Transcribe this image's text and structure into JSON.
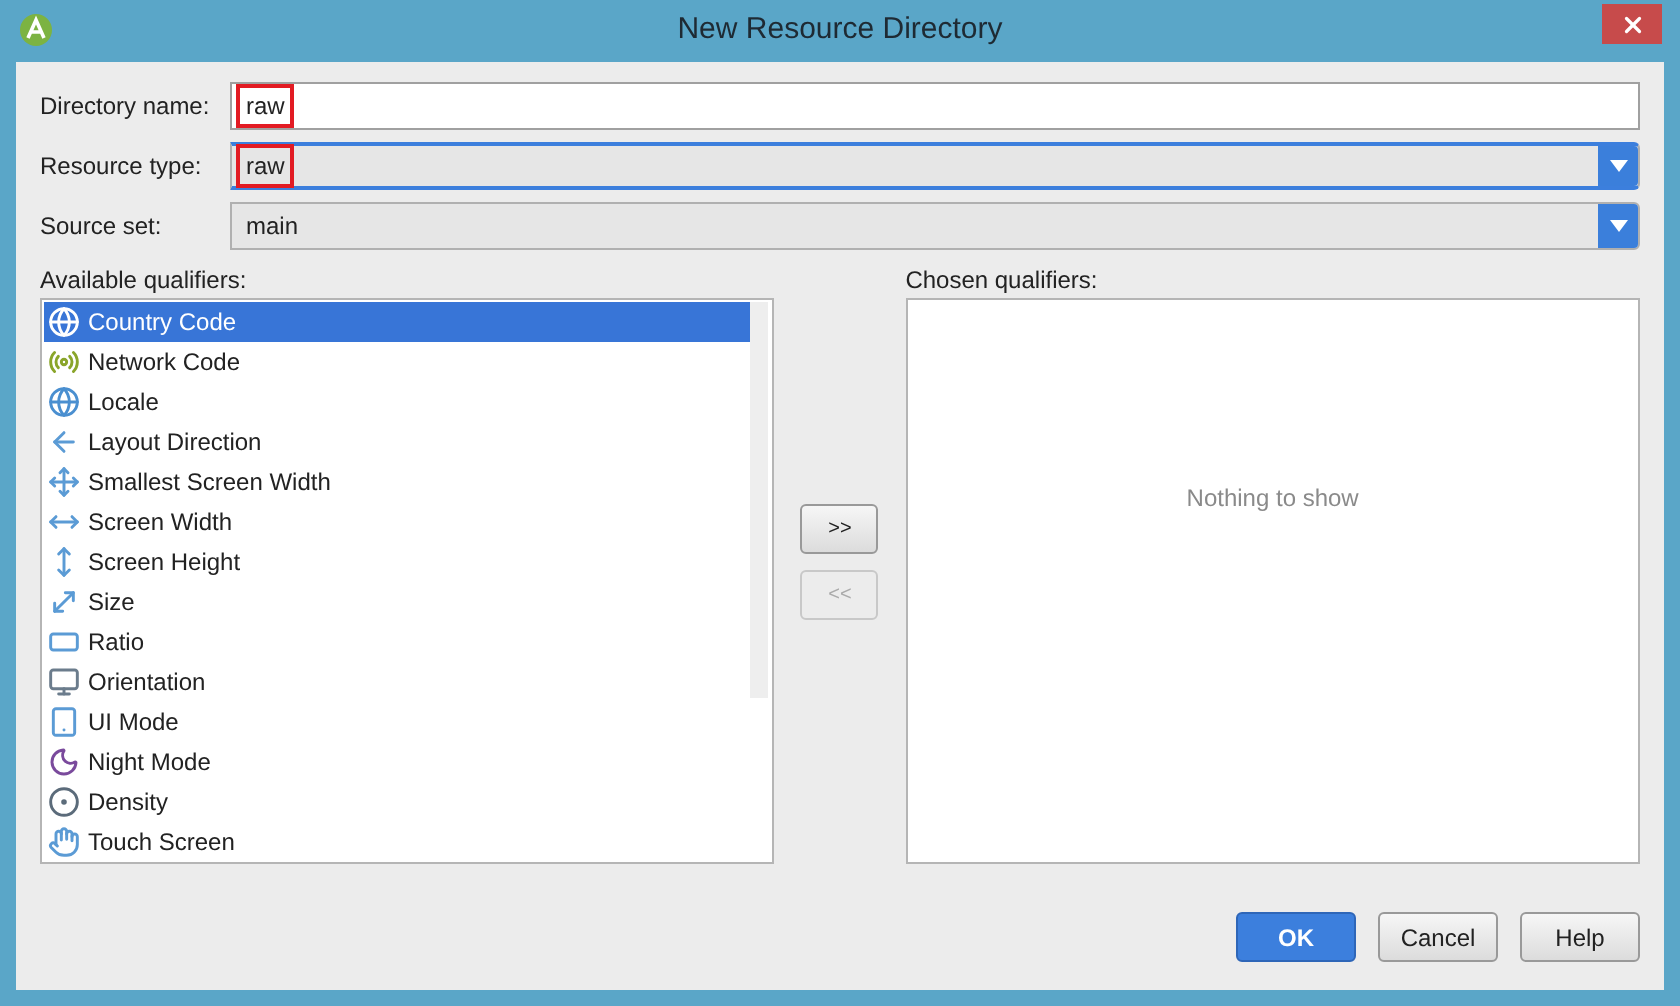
{
  "window": {
    "title": "New Resource Directory"
  },
  "fields": [
    {
      "label": "Directory name:",
      "value": "raw",
      "kind": "text",
      "focused": false,
      "highlighted": true
    },
    {
      "label": "Resource type:",
      "value": "raw",
      "kind": "dropdown",
      "focused": true,
      "highlighted": true
    },
    {
      "label": "Source set:",
      "value": "main",
      "kind": "dropdown",
      "focused": false,
      "highlighted": false
    }
  ],
  "available_qualifiers": {
    "label": "Available qualifiers:",
    "items": [
      {
        "label": "Country Code",
        "selected": true
      },
      {
        "label": "Network Code",
        "selected": false
      },
      {
        "label": "Locale",
        "selected": false
      },
      {
        "label": "Layout Direction",
        "selected": false
      },
      {
        "label": "Smallest Screen Width",
        "selected": false
      },
      {
        "label": "Screen Width",
        "selected": false
      },
      {
        "label": "Screen Height",
        "selected": false
      },
      {
        "label": "Size",
        "selected": false
      },
      {
        "label": "Ratio",
        "selected": false
      },
      {
        "label": "Orientation",
        "selected": false
      },
      {
        "label": "UI Mode",
        "selected": false
      },
      {
        "label": "Night Mode",
        "selected": false
      },
      {
        "label": "Density",
        "selected": false
      },
      {
        "label": "Touch Screen",
        "selected": false
      }
    ]
  },
  "move_buttons": [
    {
      "label": ">>",
      "disabled": false
    },
    {
      "label": "<<",
      "disabled": true
    }
  ],
  "chosen_qualifiers": {
    "label": "Chosen qualifiers:",
    "empty_text": "Nothing to show"
  },
  "buttons": [
    {
      "label": "OK",
      "kind": "primary"
    },
    {
      "label": "Cancel",
      "kind": "normal"
    },
    {
      "label": "Help",
      "kind": "normal"
    }
  ]
}
